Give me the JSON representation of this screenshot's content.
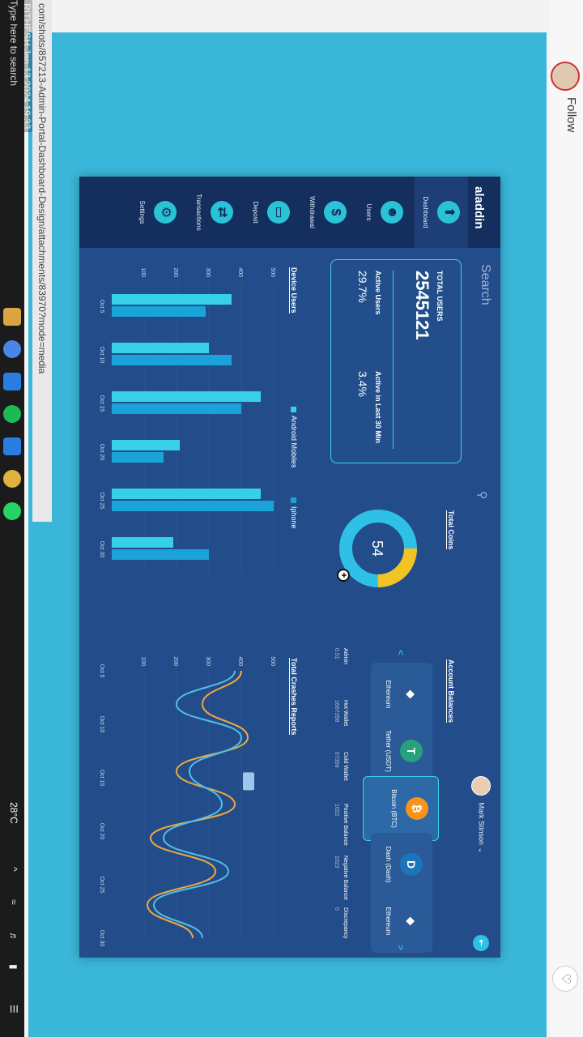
{
  "page": {
    "follow_label": "Follow",
    "heart_icon": "heart-icon"
  },
  "sidebar": {
    "logo": "aladdin",
    "items": [
      {
        "label": "Dashboard",
        "icon": "arrow-up-icon",
        "active": true
      },
      {
        "label": "Users",
        "icon": "users-icon",
        "active": false
      },
      {
        "label": "Withdrawal",
        "icon": "dollar-icon",
        "active": false
      },
      {
        "label": "Deposit",
        "icon": "card-icon",
        "active": false
      },
      {
        "label": "Transactions",
        "icon": "exchange-icon",
        "active": false
      },
      {
        "label": "Settings",
        "icon": "gear-icon",
        "active": false
      }
    ]
  },
  "header": {
    "search_placeholder": "Search",
    "user_name": "Mark Stinson"
  },
  "total_users": {
    "title": "TOTAL USERS",
    "value": "2545121",
    "active_users_label": "Active Users",
    "active_users_value": "29.7%",
    "active_30_label": "Active in Last 30 Min",
    "active_30_value": "3.4%"
  },
  "total_coins": {
    "title": "Total Coins",
    "value": "54",
    "colors": {
      "primary": "#2ec0e6",
      "secondary": "#f2c423"
    }
  },
  "account_balances": {
    "title": "Account Balances",
    "coins": [
      {
        "name": "Ethereum",
        "selected": false
      },
      {
        "name": "Tether (USDT)",
        "selected": false
      },
      {
        "name": "Bitcoin (BTC)",
        "selected": true
      },
      {
        "name": "Dash (Dash)",
        "selected": false
      },
      {
        "name": "Ethereum",
        "selected": false
      }
    ],
    "columns": [
      {
        "label": "Admin",
        "value": "0.51"
      },
      {
        "label": "Hot Wallet",
        "value": "1667358"
      },
      {
        "label": "Cold Wallet",
        "value": "67358"
      },
      {
        "label": "Positive Balance",
        "value": "1022"
      },
      {
        "label": "Negative Balance",
        "value": "1023"
      },
      {
        "label": "Discrepancy",
        "value": "0"
      }
    ]
  },
  "device_users": {
    "title": "Device Users",
    "legend": [
      "Android Mobiles",
      "Iphone"
    ]
  },
  "crash_reports": {
    "title": "Total Crashes Reports",
    "tooltip": ""
  },
  "chart_data": [
    {
      "type": "bar",
      "categories": [
        "Oct 5",
        "Oct 10",
        "Oct 15",
        "Oct 20",
        "Oct 25",
        "Oct 30"
      ],
      "ylim": [
        0,
        500
      ],
      "yticks": [
        100,
        200,
        300,
        400,
        500
      ],
      "series": [
        {
          "name": "Android Mobiles",
          "color": "#36d1e8",
          "values": [
            370,
            300,
            460,
            210,
            460,
            190
          ]
        },
        {
          "name": "Iphone",
          "color": "#1aa3d9",
          "values": [
            290,
            370,
            400,
            160,
            520,
            300
          ]
        }
      ]
    },
    {
      "type": "line",
      "x": [
        "Oct 5",
        "Oct 10",
        "Oct 15",
        "Oct 20",
        "Oct 25",
        "Oct 30"
      ],
      "ylim": [
        0,
        500
      ],
      "yticks": [
        100,
        200,
        300,
        400,
        500
      ],
      "series": [
        {
          "color": "#f2a93b",
          "values": [
            400,
            280,
            420,
            200,
            380,
            120,
            320,
            110,
            250
          ]
        },
        {
          "color": "#4fc0ea",
          "values": [
            380,
            200,
            400,
            240,
            340,
            160,
            360,
            130,
            280
          ]
        }
      ]
    }
  ],
  "browser": {
    "url": "com/shots/857213-Admin-Portal-Dashboard-Design/attachments/83970?mode=media",
    "watermark": "RITHESH Jan 13 2024 19:33",
    "taskbar_search": "Type here to search",
    "weather": "28°C"
  }
}
